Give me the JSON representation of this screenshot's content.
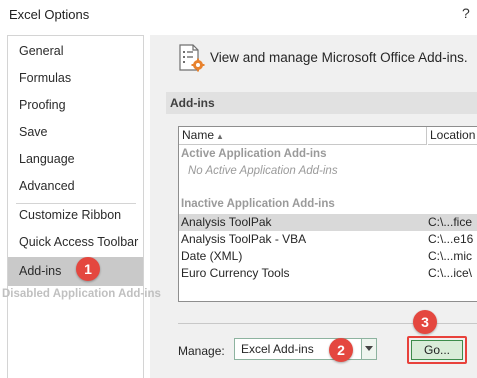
{
  "window": {
    "title": "Excel Options",
    "help_glyph": "?"
  },
  "sidebar": {
    "items": [
      {
        "label": "General"
      },
      {
        "label": "Formulas"
      },
      {
        "label": "Proofing"
      },
      {
        "label": "Save"
      },
      {
        "label": "Language"
      },
      {
        "label": "Advanced"
      },
      {
        "label": "Customize Ribbon"
      },
      {
        "label": "Quick Access Toolbar"
      },
      {
        "label": "Add-ins",
        "selected": true
      }
    ]
  },
  "main": {
    "header_icon": "addins-gear-icon",
    "header_text": "View and manage Microsoft Office Add-ins.",
    "section_title": "Add-ins"
  },
  "table": {
    "columns": [
      "Name",
      "Location"
    ],
    "sort_glyph": "▲",
    "active_group": "Active Application Add-ins",
    "active_empty": "No Active Application Add-ins",
    "inactive_group": "Inactive Application Add-ins",
    "rows": [
      {
        "name": "Analysis ToolPak",
        "location": "C:\\...fice",
        "selected": true
      },
      {
        "name": "Analysis ToolPak - VBA",
        "location": "C:\\...e16"
      },
      {
        "name": "Date (XML)",
        "location": "C:\\...mic"
      },
      {
        "name": "Euro Currency Tools",
        "location": "C:\\...ice\\"
      }
    ],
    "partial_group": "Disabled Application Add-ins"
  },
  "manage": {
    "label": "Manage:",
    "selected": "Excel Add-ins",
    "go_label": "Go..."
  },
  "markers": [
    "1",
    "2",
    "3"
  ],
  "colors": {
    "marker": "#e4473f",
    "selected_nav": "#c9c9c9",
    "go_button_fill": "#d9ecd8",
    "go_outline": "#e8413b"
  }
}
